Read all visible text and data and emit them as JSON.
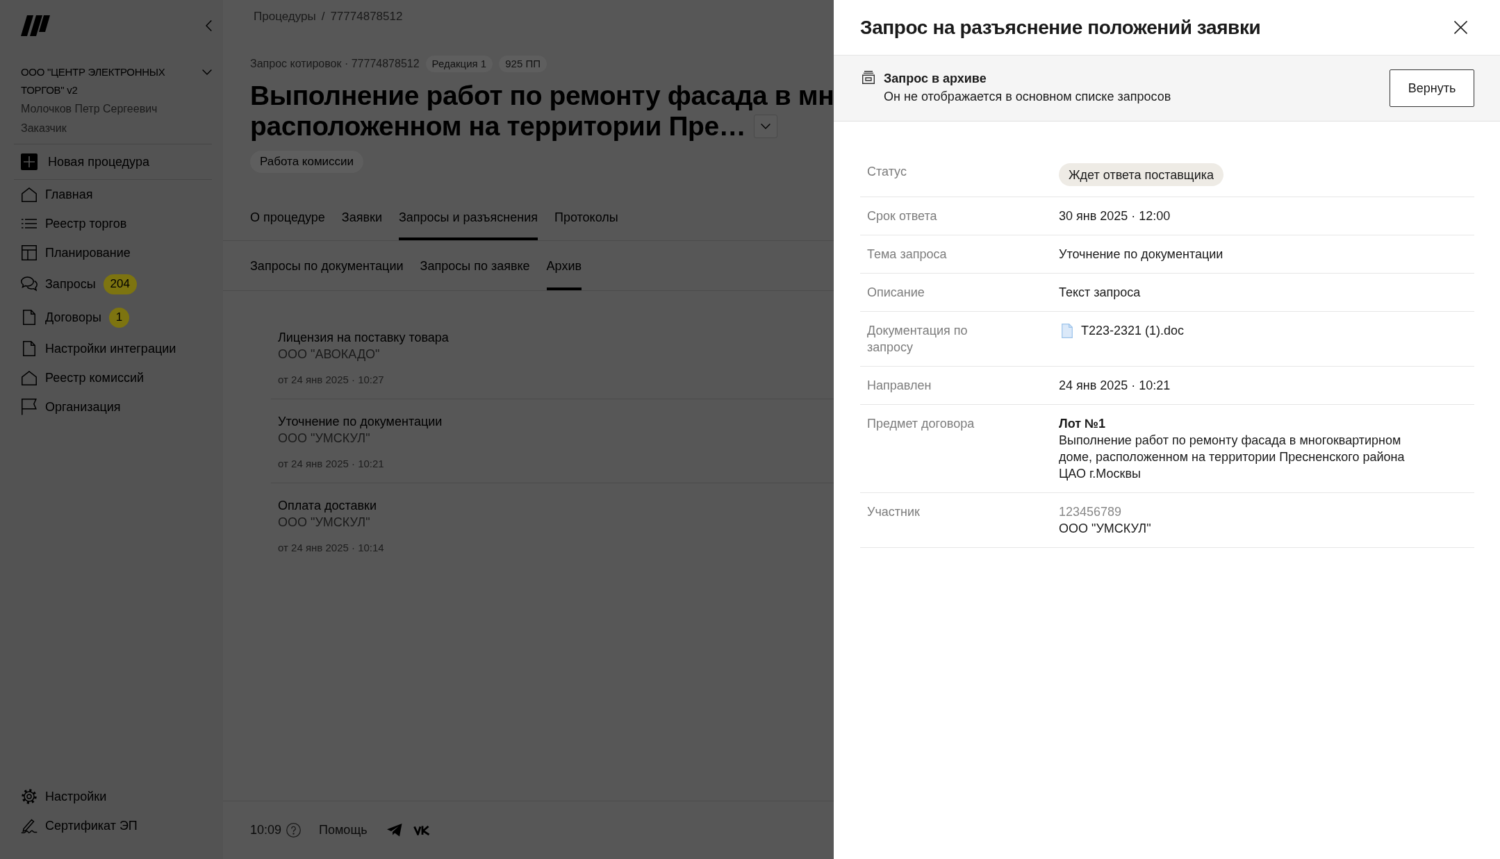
{
  "sidebar": {
    "organization": {
      "name": "ООО \"ЦЕНТР ЭЛЕКТРОННЫХ ТОРГОВ\" v2",
      "user": "Молочков Петр Сергеевич",
      "role": "Заказчик"
    },
    "new_procedure": "Новая процедура",
    "items": [
      {
        "label": "Главная"
      },
      {
        "label": "Реестр торгов"
      },
      {
        "label": "Планирование"
      },
      {
        "label": "Запросы",
        "badge": "204"
      },
      {
        "label": "Договоры",
        "badge": "1"
      },
      {
        "label": "Настройки интеграции"
      },
      {
        "label": "Реестр комиссий"
      },
      {
        "label": "Организация"
      }
    ],
    "bottom_items": [
      {
        "label": "Настройки"
      },
      {
        "label": "Сертификат ЭП"
      }
    ]
  },
  "breadcrumb": {
    "items": [
      "Процедуры",
      "77774878512"
    ],
    "separator": "/"
  },
  "procedure": {
    "meta": "Запрос котировок · 77774878512",
    "tags": [
      "Редакция 1",
      "925 ПП"
    ],
    "title_lines": [
      "Выполнение работ по ремонту фасада в мн",
      "расположенном на территории Пре…"
    ],
    "status": "Работа комиссии"
  },
  "tabs": [
    {
      "label": "О процедуре",
      "selected": false
    },
    {
      "label": "Заявки",
      "selected": false
    },
    {
      "label": "Запросы и разъяснения",
      "selected": true
    },
    {
      "label": "Протоколы",
      "selected": false
    }
  ],
  "subtabs": [
    {
      "label": "Запросы по документации",
      "selected": false
    },
    {
      "label": "Запросы по заявке",
      "selected": false
    },
    {
      "label": "Архив",
      "selected": true
    }
  ],
  "requests": [
    {
      "title": "Лицензия на поставку товара",
      "company": "ООО \"АВОКАДО\"",
      "date": "от 24 янв 2025 · 10:27"
    },
    {
      "title": "Уточнение по документации",
      "company": "ООО \"УМСКУЛ\"",
      "date": "от 24 янв 2025 · 10:21"
    },
    {
      "title": "Оплата доставки",
      "company": "ООО \"УМСКУЛ\"",
      "date": "от 24 янв 2025 · 10:14"
    }
  ],
  "footer": {
    "time": "10:09",
    "help": "Помощь"
  },
  "drawer": {
    "title": "Запрос на разъяснение положений заявки",
    "notice": {
      "title": "Запрос в архиве",
      "text": "Он не отображается в основном списке запросов",
      "button": "Вернуть"
    },
    "fields": [
      {
        "kind": "status",
        "label": "Статус",
        "value": "Ждет ответа поставщика"
      },
      {
        "kind": "text",
        "label": "Срок ответа",
        "value": "30 янв 2025 · 12:00"
      },
      {
        "kind": "text",
        "label": "Тема запроса",
        "value": "Уточнение по документации"
      },
      {
        "kind": "text",
        "label": "Описание",
        "value": "Текст запроса"
      },
      {
        "kind": "file",
        "label": "Документация по запросу",
        "value": "T223-2321 (1).doc"
      },
      {
        "kind": "text",
        "label": "Направлен",
        "value": "24 янв 2025 · 10:21"
      },
      {
        "kind": "lot",
        "label": "Предмет договора",
        "lot": "Лот №1",
        "value": "Выполнение работ по ремонту фасада в многоквартирном доме, расположенном на территории Пресненского района ЦАО г.Москвы"
      },
      {
        "kind": "participant",
        "label": "Участник",
        "id": "123456789",
        "value": "ООО \"УМСКУЛ\""
      }
    ]
  }
}
